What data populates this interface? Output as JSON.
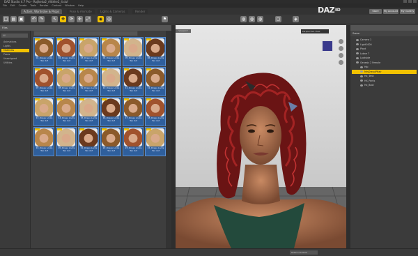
{
  "window": {
    "title": "DAZ Studio 4.7 Pro - Rajikeka2_Alitkhe2_4.duf"
  },
  "menu": [
    "File",
    "Edit",
    "Create",
    "Tools",
    "Render",
    "Content",
    "Window",
    "Help"
  ],
  "tabs": [
    {
      "label": "Actors, Wardrobe & Props"
    },
    {
      "label": "Pose & Animate"
    },
    {
      "label": "Lights & Cameras"
    },
    {
      "label": "Render"
    }
  ],
  "header": {
    "brand": "DAZ",
    "brand_suffix": "3D",
    "buttons": [
      "Store",
      "My Account",
      "My Gallery"
    ]
  },
  "left_panel": {
    "header_tabs": [
      "Files",
      "Smart Content",
      "Library"
    ],
    "filter_label": "All",
    "search_placeholder": "",
    "sidebar_items": [
      "Animations",
      "Lights",
      "Materials",
      "Poses",
      "Unassigned",
      "Utilities"
    ],
    "selected_index": 2,
    "thumbnails": [
      "01_Dreau Locks\nTex duf",
      "02_Dreau Locks\nTex duf",
      "03_Dreau Locks\nTex duf",
      "04_Dreau Locks\nTex duf",
      "05_Dreau Locks\nTex duf",
      "06_Dreau Locks\nTex duf",
      "07_Dreau Locks\nTex duf",
      "08_Dreau Locks\nTex duf",
      "09_Dreau Locks\nTex duf",
      "10_Dreau Locks\nTex duf",
      "11_Dreau Locks\nTex duf",
      "12_Dreau Locks\nTex duf",
      "13_Dreau Locks\nTex duf",
      "14_Dreau Locks\nTex duf",
      "15_Dreau Locks\nTex duf",
      "16_Dreau Locks\nTex duf",
      "17_Dreau Locks\nTex duf",
      "18_Dreau Locks\nTex duf",
      "19_Dreau Locks\nTex duf",
      "20_Dreau Locks\nTex duf",
      "21_Dreau Locks\nTex duf",
      "22_Dreau Locks\nTex duf",
      "23_Dreau Locks\nTex duf",
      "24_Dreau Locks\nTex duf"
    ]
  },
  "viewport": {
    "tab_label": "Viewport",
    "camera_select": "Perspective View"
  },
  "scene": {
    "header": "Scene",
    "rows": [
      {
        "label": "Camera 1",
        "indent": 1
      },
      {
        "label": "Light1000",
        "indent": 1
      },
      {
        "label": "Plant",
        "indent": 1
      },
      {
        "label": "Lobne 7",
        "indent": 1
      },
      {
        "label": "Lockside",
        "indent": 1
      },
      {
        "label": "Genesis 2 Female",
        "indent": 1
      },
      {
        "label": "Hip",
        "indent": 2
      },
      {
        "label": "MrsDreauPHair",
        "indent": 2,
        "selected": true
      },
      {
        "label": "Hx_Tank",
        "indent": 2
      },
      {
        "label": "HX_Pants",
        "indent": 2
      },
      {
        "label": "Hx_Boot",
        "indent": 2
      }
    ]
  },
  "status": {
    "select_label": "Select a Lesson"
  },
  "colors": {
    "accent": "#f2c200",
    "thumb_bg": "#2f5f9c",
    "hair": "#8a1a1a"
  }
}
